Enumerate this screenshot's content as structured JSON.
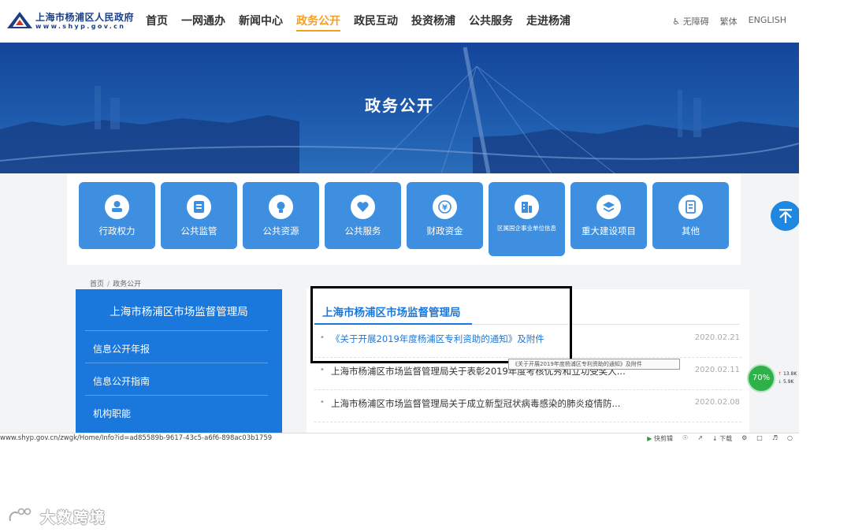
{
  "header": {
    "logo_cn": "上海市杨浦区人民政府",
    "logo_en": "www.shyp.gov.cn",
    "nav": [
      "首页",
      "一网通办",
      "新闻中心",
      "政务公开",
      "政民互动",
      "投资杨浦",
      "公共服务",
      "走进杨浦"
    ],
    "active_nav": "政务公开",
    "accessibility": "无障碍",
    "traditional": "繁体",
    "english": "ENGLISH"
  },
  "banner": {
    "title": "政务公开"
  },
  "categories": [
    {
      "label": "行政权力",
      "icon": "person-icon"
    },
    {
      "label": "公共监管",
      "icon": "monitor-icon"
    },
    {
      "label": "公共资源",
      "icon": "lightbulb-icon"
    },
    {
      "label": "公共服务",
      "icon": "heart-icon"
    },
    {
      "label": "财政资金",
      "icon": "yuan-icon"
    },
    {
      "label": "区属国企事业单位信息",
      "icon": "building-icon"
    },
    {
      "label": "重大建设项目",
      "icon": "layers-icon"
    },
    {
      "label": "其他",
      "icon": "document-icon"
    }
  ],
  "breadcrumb": [
    "首页",
    "政务公开"
  ],
  "sidebar": {
    "title": "上海市杨浦区市场监督管理局",
    "items": [
      "信息公开年报",
      "信息公开指南",
      "机构职能"
    ]
  },
  "content": {
    "tab": "上海市杨浦区市场监督管理局",
    "news": [
      {
        "title": "《关于开展2019年度杨浦区专利资助的通知》及附件",
        "date": "2020.02.21"
      },
      {
        "title": "上海市杨浦区市场监督管理局关于表彰2019年度考核优秀和立功受奖人...",
        "date": "2020.02.11"
      },
      {
        "title": "上海市杨浦区市场监督管理局关于成立新型冠状病毒感染的肺炎疫情防...",
        "date": "2020.02.08"
      }
    ],
    "tooltip": "《关于开展2019年度杨浦区专利资助的通知》及附件"
  },
  "statusbar": {
    "url": "www.shyp.gov.cn/zwgk/Home/Info?id=ad85589b-9617-43c5-a6f6-898ac03b1759",
    "tools": [
      "快剪辑",
      "下载"
    ]
  },
  "net_meter": {
    "percent": "70%",
    "up": "13.8K",
    "down": "5.9K"
  },
  "watermark": {
    "text": "大数跨境"
  },
  "colors": {
    "primary": "#1a78dc",
    "tile": "#3f8fe0",
    "accent": "#f3a11d",
    "banner": "#1d5aad"
  }
}
